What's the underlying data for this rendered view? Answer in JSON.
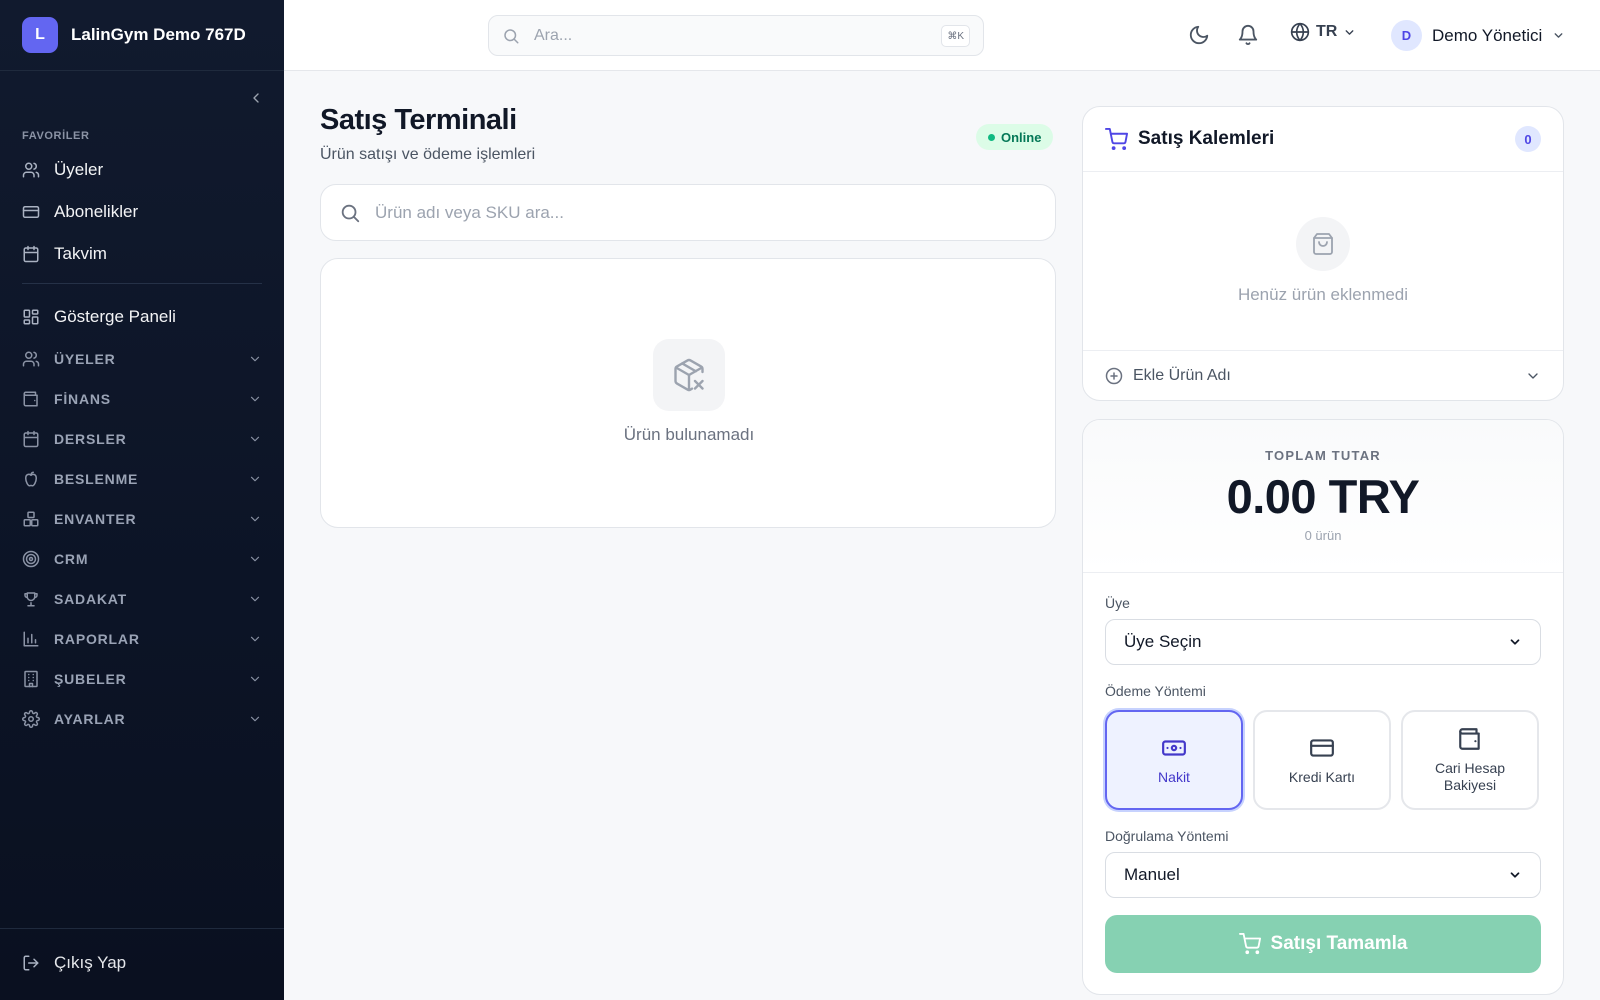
{
  "brand": {
    "logo_letter": "L",
    "name": "LalinGym Demo 767D"
  },
  "sidebar": {
    "favorites_label": "FAVORİLER",
    "favorites": [
      {
        "label": "Üyeler",
        "icon": "users-icon"
      },
      {
        "label": "Abonelikler",
        "icon": "credit-card-icon"
      },
      {
        "label": "Takvim",
        "icon": "calendar-icon"
      }
    ],
    "dashboard": {
      "label": "Gösterge Paneli",
      "icon": "dashboard-grid-icon"
    },
    "sections": [
      {
        "label": "ÜYELER",
        "icon": "users-icon"
      },
      {
        "label": "FİNANS",
        "icon": "wallet-icon"
      },
      {
        "label": "DERSLER",
        "icon": "calendar-icon"
      },
      {
        "label": "BESLENME",
        "icon": "apple-icon"
      },
      {
        "label": "ENVANTER",
        "icon": "boxes-icon"
      },
      {
        "label": "CRM",
        "icon": "target-icon"
      },
      {
        "label": "SADAKAT",
        "icon": "trophy-icon"
      },
      {
        "label": "RAPORLAR",
        "icon": "bar-chart-icon"
      },
      {
        "label": "ŞUBELER",
        "icon": "building-icon"
      },
      {
        "label": "AYARLAR",
        "icon": "gear-icon"
      }
    ],
    "logout": "Çıkış Yap"
  },
  "topbar": {
    "search_placeholder": "Ara...",
    "search_shortcut": "⌘K",
    "language": "TR",
    "user": {
      "initial": "D",
      "name": "Demo Yönetici"
    }
  },
  "main": {
    "title": "Satış Terminali",
    "subtitle": "Ürün satışı ve ödeme işlemleri",
    "status": "Online",
    "product_search_placeholder": "Ürün adı veya SKU ara...",
    "empty_products": "Ürün bulunamadı"
  },
  "cart": {
    "title": "Satış Kalemleri",
    "count": "0",
    "empty": "Henüz ürün eklenmedi",
    "add_label": "Ekle Ürün Adı"
  },
  "checkout": {
    "total_label": "TOPLAM TUTAR",
    "total_value": "0.00 TRY",
    "item_count": "0 ürün",
    "member_label": "Üye",
    "member_value": "Üye Seçin",
    "payment_label": "Ödeme Yöntemi",
    "payment_methods": [
      {
        "label": "Nakit",
        "icon": "cash-icon",
        "selected": true
      },
      {
        "label": "Kredi Kartı",
        "icon": "credit-card-icon",
        "selected": false
      },
      {
        "label": "Cari Hesap Bakiyesi",
        "icon": "wallet-icon",
        "selected": false
      }
    ],
    "verification_label": "Doğrulama Yöntemi",
    "verification_value": "Manuel",
    "complete_button": "Satışı Tamamla"
  },
  "colors": {
    "accent": "#6366f1",
    "sidebar_bg": "#0f172a",
    "online_bg": "#dcfce7",
    "complete_button": "#86d1b2"
  }
}
